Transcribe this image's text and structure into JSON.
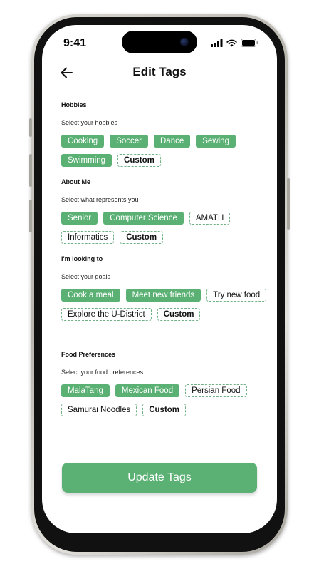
{
  "status_bar": {
    "time": "9:41"
  },
  "header": {
    "title": "Edit Tags"
  },
  "sections": [
    {
      "title": "Hobbies",
      "subtitle": "Select your hobbies",
      "tags": [
        {
          "label": "Cooking",
          "state": "selected"
        },
        {
          "label": "Soccer",
          "state": "selected"
        },
        {
          "label": "Dance",
          "state": "selected"
        },
        {
          "label": "Sewing",
          "state": "selected"
        },
        {
          "label": "Swimming",
          "state": "selected"
        },
        {
          "label": "Custom",
          "state": "custom"
        }
      ]
    },
    {
      "title": "About Me",
      "subtitle": "Select what represents you",
      "tags": [
        {
          "label": "Senior",
          "state": "selected"
        },
        {
          "label": "Computer Science",
          "state": "selected"
        },
        {
          "label": "AMATH",
          "state": "unselected"
        },
        {
          "label": "Informatics",
          "state": "unselected"
        },
        {
          "label": "Custom",
          "state": "custom"
        }
      ]
    },
    {
      "title": "I'm looking to",
      "subtitle": "Select your goals",
      "tags": [
        {
          "label": "Cook a meal",
          "state": "selected"
        },
        {
          "label": "Meet new friends",
          "state": "selected"
        },
        {
          "label": "Try new food",
          "state": "unselected"
        },
        {
          "label": "Explore the U-District",
          "state": "unselected"
        },
        {
          "label": "Custom",
          "state": "custom"
        }
      ]
    },
    {
      "title": "Food Preferences",
      "subtitle": "Select your food preferences",
      "tags": [
        {
          "label": "MalaTang",
          "state": "selected"
        },
        {
          "label": "Mexican Food",
          "state": "selected"
        },
        {
          "label": "Persian Food",
          "state": "unselected"
        },
        {
          "label": "Samurai Noodles",
          "state": "unselected"
        },
        {
          "label": "Custom",
          "state": "custom"
        }
      ]
    }
  ],
  "update_button": {
    "label": "Update Tags"
  },
  "colors": {
    "accent": "#5bb074",
    "dashed_border": "#6fb184",
    "text": "#111111"
  },
  "icons": {
    "back": "arrow-left-icon",
    "signal": "cellular-signal-icon",
    "wifi": "wifi-icon",
    "battery": "battery-icon"
  }
}
